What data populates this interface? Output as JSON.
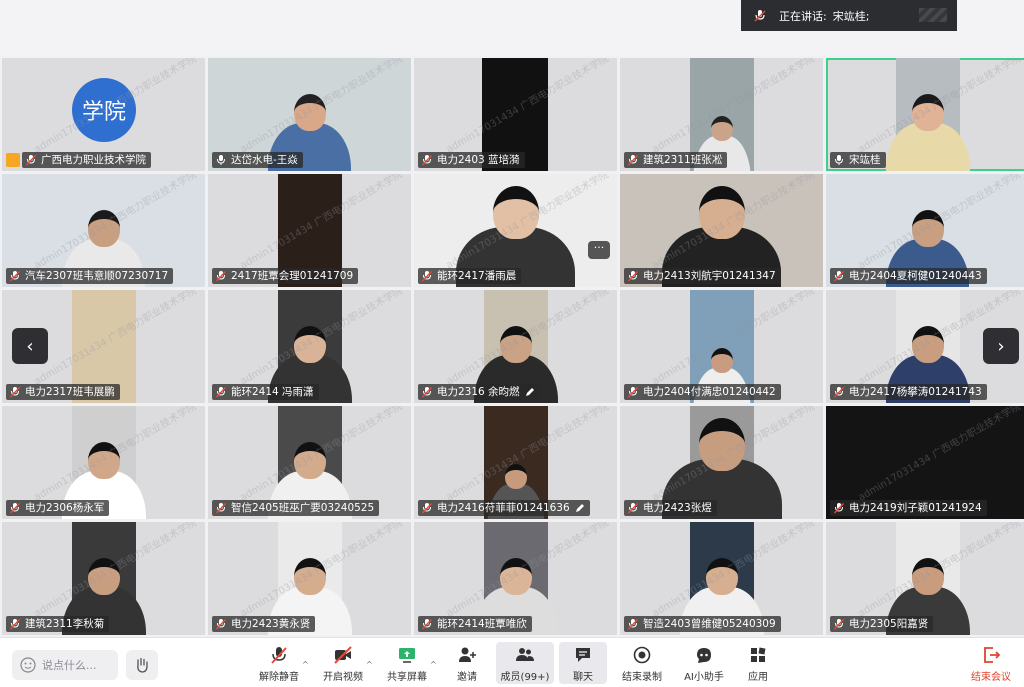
{
  "speaking": {
    "label": "正在讲话:",
    "speaker": "宋竑桂;"
  },
  "watermark": "admin17031434 广西电力职业技术学院 8548",
  "tiles": [
    {
      "name": "广西电力职业技术学院",
      "avatar_text": "学院",
      "host": true
    },
    {
      "name": "达岱水电-王焱"
    },
    {
      "name": "电力2403 蓝培漪"
    },
    {
      "name": "建筑2311班张凇"
    },
    {
      "name": "宋竑桂",
      "active": true
    },
    {
      "name": "汽车2307班韦意顺07230717"
    },
    {
      "name": "2417班覃会理01241709"
    },
    {
      "name": "能环2417潘雨晨"
    },
    {
      "name": "电力2413刘航宇01241347"
    },
    {
      "name": "电力2404夏柯健01240443"
    },
    {
      "name": "电力2317班韦展鹏"
    },
    {
      "name": "能环2414 冯雨潇"
    },
    {
      "name": "电力2316 余昀燃",
      "pen": true
    },
    {
      "name": "电力2404付满忠01240442"
    },
    {
      "name": "电力2417杨攀涛01241743"
    },
    {
      "name": "电力2306杨永军"
    },
    {
      "name": "智信2405班巫广要03240525"
    },
    {
      "name": "电力2416苻菲菲01241636",
      "pen": true
    },
    {
      "name": "电力2423张煜"
    },
    {
      "name": "电力2419刘子颖01241924"
    },
    {
      "name": "建筑2311李秋菊"
    },
    {
      "name": "电力2423黄永贤"
    },
    {
      "name": "能环2414班覃唯欣"
    },
    {
      "name": "智造2403曾维健05240309"
    },
    {
      "name": "电力2305阳嘉贤"
    }
  ],
  "more_label": "···",
  "nav": {
    "prev": "‹",
    "next": "›"
  },
  "toolbar": {
    "chat_placeholder": "说点什么...",
    "mute": "解除静音",
    "video": "开启视频",
    "share": "共享屏幕",
    "invite": "邀请",
    "members": "成员(99+)",
    "chat": "聊天",
    "record": "结束录制",
    "ai": "AI小助手",
    "apps": "应用",
    "end": "结束会议"
  },
  "colors": {
    "accent": "#3ecf8e",
    "avatar": "#2f6fcf",
    "end": "#e0442c",
    "host": "#f5a623"
  }
}
